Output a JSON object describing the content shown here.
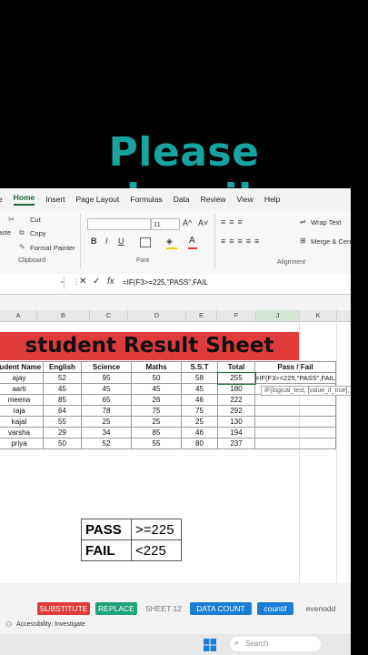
{
  "banner": {
    "text": "Please subscribe"
  },
  "ribbon": {
    "tabs": [
      "le",
      "Home",
      "Insert",
      "Page Layout",
      "Formulas",
      "Data",
      "Review",
      "View",
      "Help"
    ],
    "clipboard": {
      "cut": "Cut",
      "copy": "Copy",
      "paste": "aste",
      "format_painter": "Format Painter",
      "label": "Clipboard"
    },
    "font": {
      "size": "11",
      "grow": "A^",
      "shrink": "A˅",
      "bold": "B",
      "italic": "I",
      "underline": "U",
      "label": "Font"
    },
    "alignment": {
      "wrap_text": "Wrap Text",
      "merge": "Merge & Cen",
      "label": "Alignment"
    }
  },
  "formula_bar": {
    "fx": "fx",
    "formula": "=IF(F3>=225,\"PASS\",FAIL"
  },
  "columns": [
    "A",
    "B",
    "C",
    "D",
    "E",
    "F",
    "J",
    "K"
  ],
  "sheet": {
    "title": "student Result Sheet",
    "headers": [
      "tudent Name",
      "English",
      "Science",
      "Maths",
      "S.S.T",
      "Total",
      "Pass / Fail"
    ],
    "rows": [
      [
        "ajay",
        "52",
        "95",
        "50",
        "58",
        "255"
      ],
      [
        "aarti",
        "45",
        "45",
        "45",
        "45",
        "180"
      ],
      [
        "meena",
        "85",
        "65",
        "26",
        "46",
        "222"
      ],
      [
        "raja",
        "64",
        "78",
        "75",
        "75",
        "292"
      ],
      [
        "kajal",
        "55",
        "25",
        "25",
        "25",
        "130"
      ],
      [
        "varsha",
        "29",
        "34",
        "85",
        "46",
        "194"
      ],
      [
        "priya",
        "50",
        "52",
        "55",
        "80",
        "237"
      ]
    ],
    "editing_formula": "=IF(F3>=225,\"PASS\",FAIL",
    "tooltip": "IF(logical_test, [value_if_true],"
  },
  "legend": [
    {
      "label": "PASS",
      "value": ">=225"
    },
    {
      "label": "FAIL",
      "value": "<225"
    }
  ],
  "sheet_tabs": [
    {
      "label": "SUBSTITUTE",
      "color": "#e03b3b",
      "text": "#ffffff"
    },
    {
      "label": "REPLACE",
      "color": "#1fa37a",
      "text": "#ffffff"
    },
    {
      "label": "SHEET 12",
      "color": "#f3f3f3",
      "text": "#777777"
    },
    {
      "label": "DATA COUNT",
      "color": "#1a7fd4",
      "text": "#ffffff"
    },
    {
      "label": "countif",
      "color": "#1a7fd4",
      "text": "#ffffff"
    },
    {
      "label": "evenodd",
      "color": "#f3f3f3",
      "text": "#555555"
    }
  ],
  "status": {
    "accessibility": "Accessibility: Investigate"
  },
  "taskbar": {
    "search_placeholder": "Search"
  }
}
